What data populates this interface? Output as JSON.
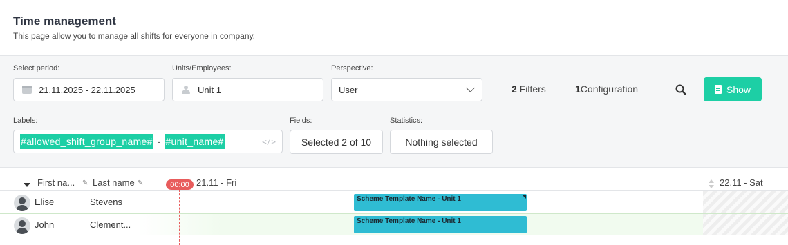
{
  "page": {
    "title": "Time management",
    "subtitle": "This page allow you to manage all shifts for everyone in company."
  },
  "filters": {
    "period": {
      "label": "Select period:",
      "value": "21.11.2025 - 22.11.2025"
    },
    "units": {
      "label": "Units/Employees:",
      "value": "Unit 1"
    },
    "perspective": {
      "label": "Perspective:",
      "value": "User"
    },
    "filters_count": {
      "count": "2",
      "text": "Filters"
    },
    "configuration_count": {
      "count": "1",
      "text": "Configuration"
    },
    "show_label": "Show",
    "labels": {
      "label": "Labels:",
      "tag1": "#allowed_shift_group_name#",
      "separator": "-",
      "tag2": "#unit_name#",
      "code_glyph": "</>"
    },
    "fields": {
      "label": "Fields:",
      "value": "Selected 2 of 10"
    },
    "statistics": {
      "label": "Statistics:",
      "value": "Nothing selected"
    }
  },
  "grid": {
    "columns": {
      "first_name": "First na...",
      "last_name": "Last name"
    },
    "now_badge": "00:00",
    "days": [
      "21.11 - Fri",
      "22.11 - Sat"
    ],
    "rows": [
      {
        "first": "Elise",
        "last": "Stevens",
        "shift": "Scheme Template Name - Unit 1"
      },
      {
        "first": "John",
        "last": "Clement...",
        "shift": "Scheme Template Name - Unit 1"
      }
    ]
  },
  "colors": {
    "accent": "#1dcfa5",
    "shift": "#2fbcd3",
    "now": "#e85c5c"
  }
}
